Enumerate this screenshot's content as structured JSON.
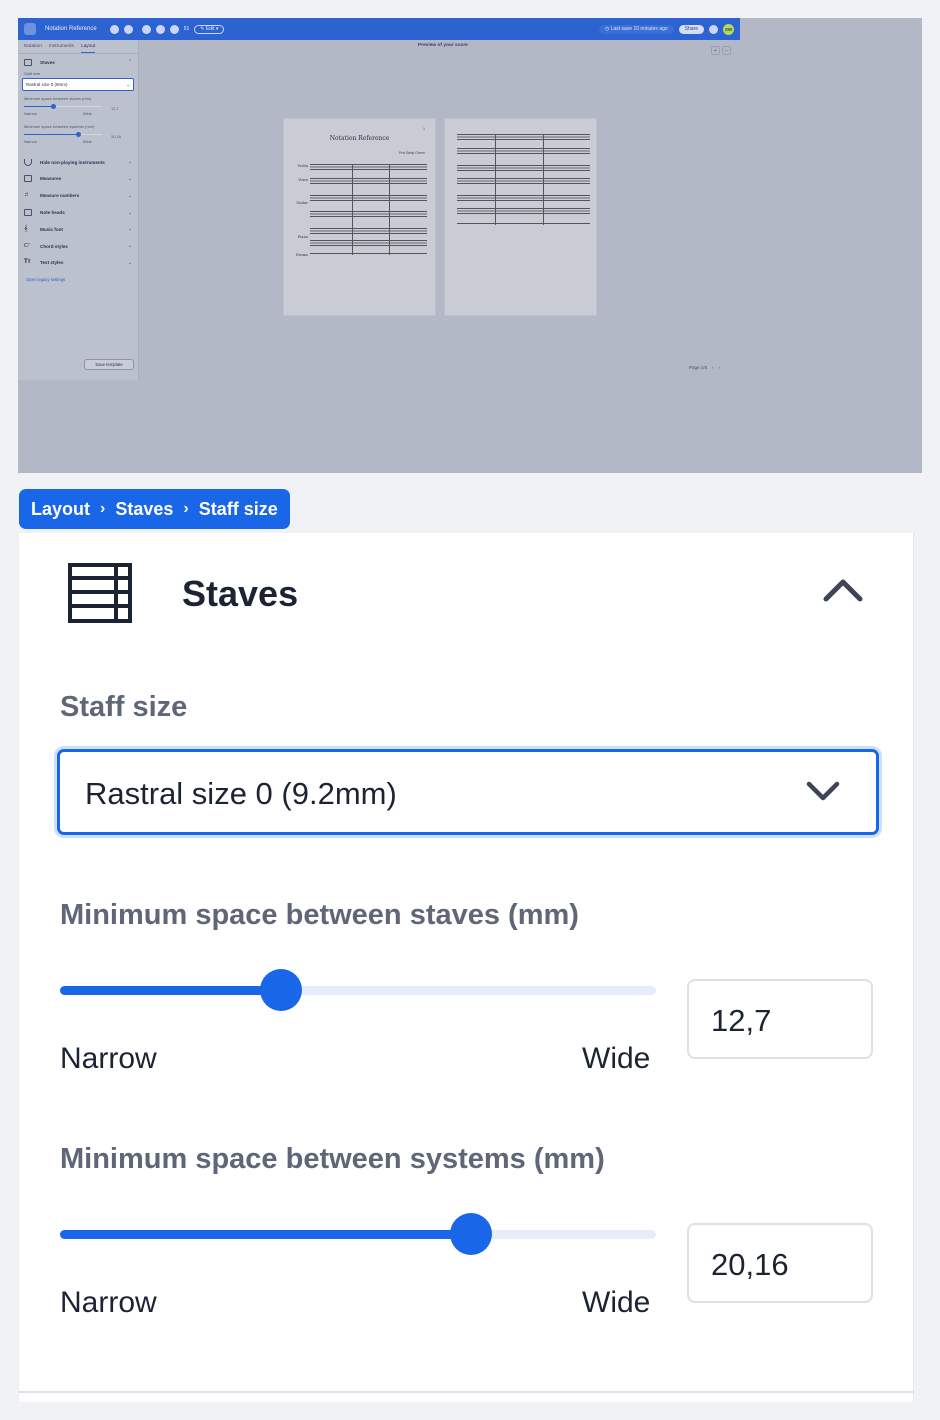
{
  "app": {
    "title": "Notation Reference",
    "measure_count": "51",
    "edit_label": "✎ Edit ▾",
    "last_save": "◷ Last save 10 minutes ago",
    "share_label": "Share",
    "avatar_initials": "SW",
    "accent_color": "#2d63d0"
  },
  "sidebar": {
    "tabs": [
      {
        "label": "Notation"
      },
      {
        "label": "Instruments"
      },
      {
        "label": "Layout"
      }
    ],
    "staves_title": "Staves",
    "staff_size_label": "Staff size",
    "staff_size_value": "Rastral size 0 (9mm)",
    "min_staves_label": "Minimum space between staves (mm)",
    "min_staves_value": "12,7",
    "min_systems_label": "Minimum space between systems (mm)",
    "min_systems_value": "20,16",
    "narrow": "Narrow",
    "wide": "Wide",
    "sections": [
      {
        "label": "Hide non-playing instruments",
        "icon": "curve-icon"
      },
      {
        "label": "Measures",
        "icon": "measures-icon"
      },
      {
        "label": "Measure numbers",
        "icon": "measure-numbers-icon"
      },
      {
        "label": "Note heads",
        "icon": "note-heads-icon"
      },
      {
        "label": "Music font",
        "icon": "music-font-icon"
      },
      {
        "label": "Chord styles",
        "icon": "chord-styles-icon"
      },
      {
        "label": "Text styles",
        "icon": "text-styles-icon"
      }
    ],
    "legacy_link": "Open legacy settings",
    "save_template": "Save template"
  },
  "preview": {
    "title": "Preview of your score",
    "score_title": "Notation Reference",
    "composer": "Prof Betty Green",
    "page_number": "1",
    "instruments": [
      "Violin",
      "Voice",
      "Guitar",
      "Piano",
      "Drums"
    ],
    "pager": "Page 1/8"
  },
  "breadcrumb": {
    "items": [
      "Layout",
      "Staves",
      "Staff size"
    ],
    "separator": "›",
    "color": "#1966e8"
  },
  "zoom_panel": {
    "title": "Staves",
    "staff_size_label": "Staff size",
    "staff_size_value": "Rastral size 0 (9.2mm)",
    "min_staves": {
      "label": "Minimum space between staves (mm)",
      "value": "12,7",
      "slider_fraction": 0.37,
      "narrow": "Narrow",
      "wide": "Wide"
    },
    "min_systems": {
      "label": "Minimum space between systems (mm)",
      "value": "20,16",
      "slider_fraction": 0.69,
      "narrow": "Narrow",
      "wide": "Wide"
    }
  }
}
